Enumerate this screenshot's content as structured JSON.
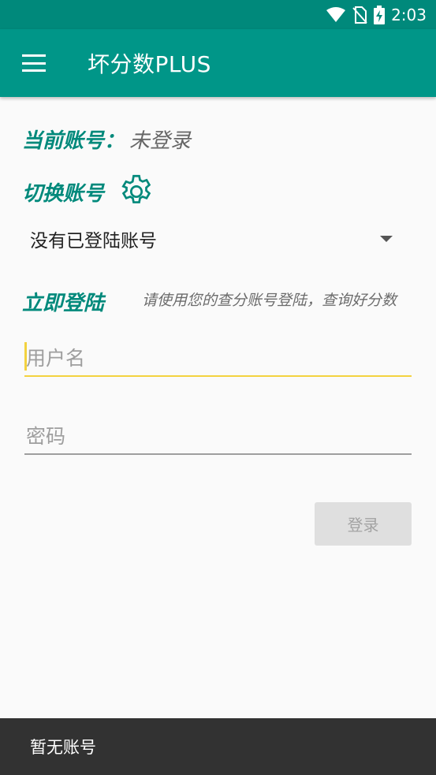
{
  "status_bar": {
    "time": "2:03",
    "icons": [
      "wifi-icon",
      "no-sim-icon",
      "battery-charging-icon"
    ]
  },
  "app_bar": {
    "title": "坏分数PLUS",
    "menu_icon": "hamburger-menu-icon"
  },
  "colors": {
    "primary": "#009688",
    "primary_dark": "#00897b",
    "accent": "#f3d23f",
    "snackbar": "#323232"
  },
  "account": {
    "current_label": "当前账号：",
    "current_value": "未登录",
    "switch_label": "切换账号",
    "settings_icon": "gear-icon",
    "dropdown_selected": "没有已登陆账号"
  },
  "login": {
    "heading": "立即登陆",
    "hint": "请使用您的查分账号登陆，查询好分数",
    "username_placeholder": "用户名",
    "username_value": "",
    "password_placeholder": "密码",
    "password_value": "",
    "button_label": "登录"
  },
  "snackbar": {
    "message": "暂无账号"
  }
}
